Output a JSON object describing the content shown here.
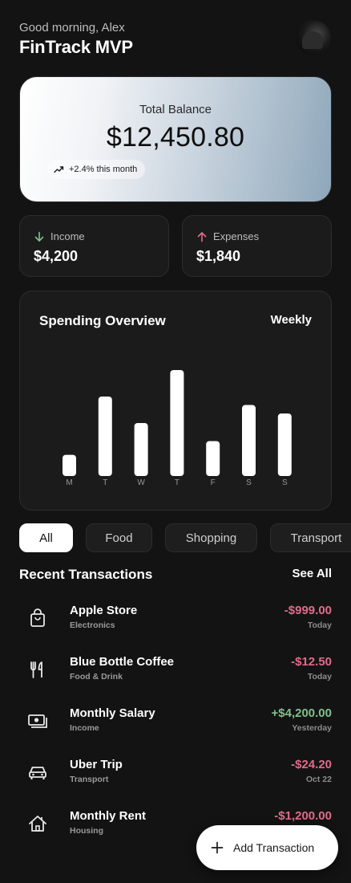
{
  "header": {
    "greeting": "Good morning, Alex",
    "title": "FinTrack MVP"
  },
  "avatar": {
    "icon": "user-avatar"
  },
  "balance": {
    "label": "Total Balance",
    "value": "$12,450.80",
    "trend": "+2.4% this month"
  },
  "stats": {
    "income": {
      "label": "Income",
      "value": "$4,200",
      "color": "#7fc28a"
    },
    "expenses": {
      "label": "Expenses",
      "value": "$1,840",
      "color": "#e06b8a"
    }
  },
  "chart_data": {
    "type": "bar",
    "title": "Spending Overview",
    "period": "Weekly",
    "categories": [
      "M",
      "T",
      "W",
      "T",
      "F",
      "S",
      "S"
    ],
    "values": [
      20,
      75,
      50,
      100,
      33,
      67,
      59
    ],
    "ylim": [
      0,
      100
    ],
    "grid": false,
    "bar_color": "#ffffff"
  },
  "filters": [
    "All",
    "Food",
    "Shopping",
    "Transport"
  ],
  "transactions_section": {
    "title": "Recent Transactions",
    "see_all": "See All"
  },
  "transactions": [
    {
      "name": "Apple Store",
      "category": "Electronics",
      "amount": "-$999.00",
      "date": "Today",
      "icon": "shopping-bag-icon",
      "color": "#e06b8a"
    },
    {
      "name": "Blue Bottle Coffee",
      "category": "Food & Drink",
      "amount": "-$12.50",
      "date": "Today",
      "icon": "utensils-icon",
      "color": "#e06b8a"
    },
    {
      "name": "Monthly Salary",
      "category": "Income",
      "amount": "+$4,200.00",
      "date": "Yesterday",
      "icon": "money-icon",
      "color": "#7fc28a"
    },
    {
      "name": "Uber Trip",
      "category": "Transport",
      "amount": "-$24.20",
      "date": "Oct 22",
      "icon": "car-icon",
      "color": "#e06b8a"
    },
    {
      "name": "Monthly Rent",
      "category": "Housing",
      "amount": "-$1,200.00",
      "date": "",
      "icon": "home-icon",
      "color": "#e06b8a"
    }
  ],
  "fab": {
    "label": "Add Transaction"
  }
}
